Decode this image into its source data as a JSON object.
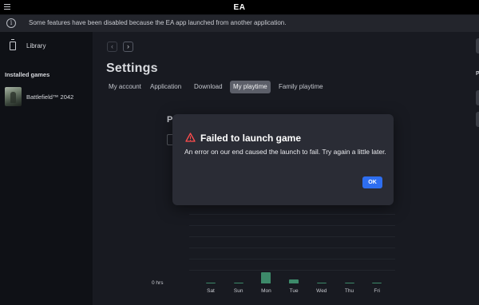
{
  "app": {
    "title": "EA"
  },
  "banner": {
    "text": "Some features have been disabled because the EA app launched from another application."
  },
  "sidebar": {
    "library_label": "Library",
    "installed_label": "Installed games",
    "games": [
      {
        "name": "Battlefield™ 2042"
      }
    ]
  },
  "main": {
    "page_title": "Settings",
    "tabs": [
      {
        "label": "My account",
        "active": false
      },
      {
        "label": "Application",
        "active": false
      },
      {
        "label": "Download",
        "active": false
      },
      {
        "label": "My playtime",
        "active": true
      },
      {
        "label": "Family playtime",
        "active": false
      }
    ],
    "section_heading": "P",
    "right_label": "P"
  },
  "chart_data": {
    "type": "bar",
    "categories": [
      "Sat",
      "Sun",
      "Mon",
      "Tue",
      "Wed",
      "Thu",
      "Fri"
    ],
    "values": [
      0.02,
      0.02,
      0.35,
      0.12,
      0.02,
      0.02,
      0.02
    ],
    "ylabel_zero": "0 hrs",
    "bar_color": "#3d8a6a"
  },
  "dialog": {
    "title": "Failed to launch game",
    "message": "An error on our end caused the launch to fail. Try again a little later.",
    "ok_label": "OK",
    "warning_color": "#ff4d4d",
    "button_color": "#2e6ef0"
  },
  "icons": {
    "menu": "hamburger-icon",
    "info": "info-icon",
    "library": "library-icon",
    "back": "chevron-left-icon",
    "forward": "chevron-right-icon",
    "warning": "warning-icon"
  }
}
